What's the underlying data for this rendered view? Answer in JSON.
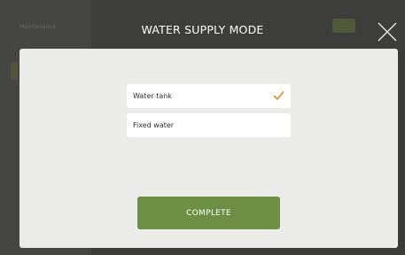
{
  "background": {
    "sidebar_title": "Maintenance"
  },
  "dialog": {
    "title": "WATER SUPPLY MODE",
    "options": [
      {
        "label": "Water tank",
        "selected": true
      },
      {
        "label": "Fixed water",
        "selected": false
      }
    ],
    "complete_label": "COMPLETE",
    "close_icon": "close-icon",
    "check_icon": "checkmark-icon"
  },
  "colors": {
    "accent": "#e08a2a",
    "button": "#6d8f43",
    "panel": "#ebebea",
    "overlay": "#3b3b39"
  }
}
